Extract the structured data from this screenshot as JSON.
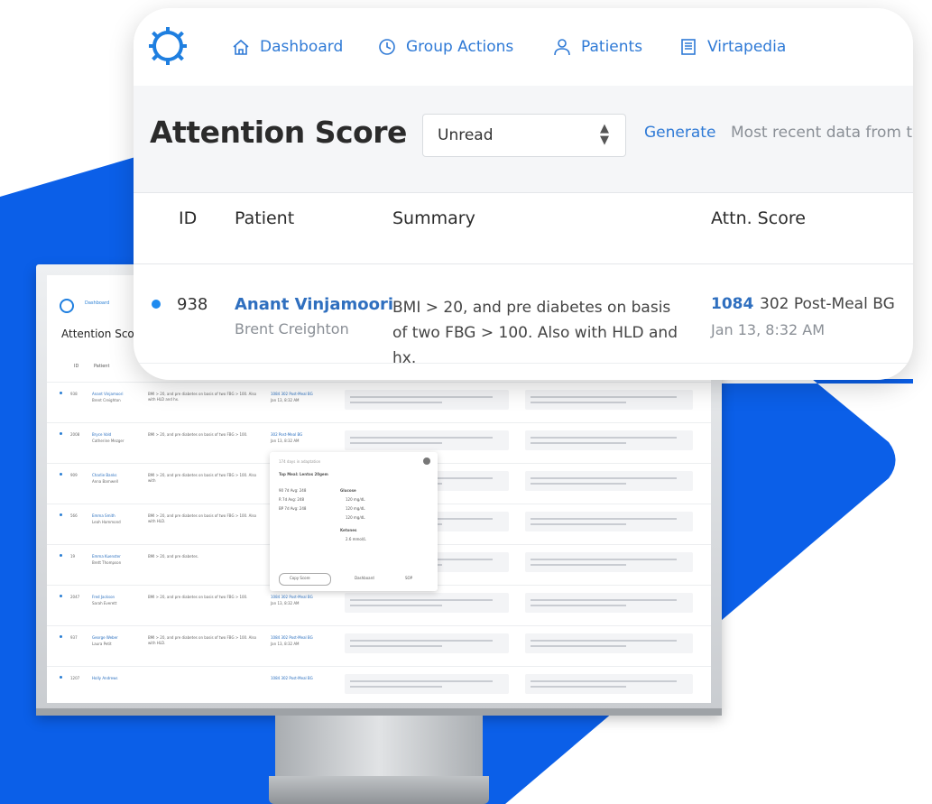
{
  "colors": {
    "brand_blue": "#0b5fe8",
    "link_blue": "#2f7ad6",
    "unread_dot": "#1f8bef"
  },
  "nav": {
    "logo_icon": "gear-icon",
    "items": [
      {
        "label": "Dashboard",
        "icon": "home-icon"
      },
      {
        "label": "Group Actions",
        "icon": "clock-icon"
      },
      {
        "label": "Patients",
        "icon": "user-icon"
      },
      {
        "label": "Virtapedia",
        "icon": "book-icon"
      }
    ]
  },
  "toolbar": {
    "title": "Attention Score",
    "filter": {
      "selected": "Unread",
      "icon": "select-arrows-icon"
    },
    "generate_label": "Generate",
    "recent_text": "Most recent data from to"
  },
  "table": {
    "columns": [
      "ID",
      "Patient",
      "Summary",
      "Attn. Score"
    ],
    "rows": [
      {
        "unread": true,
        "id": "938",
        "patient": "Anant Vinjamoori",
        "provider": "Brent Creighton",
        "summary": "BMI > 20, and pre diabetes on basis of two FBG > 100. Also with HLD and hx.",
        "score": "1084",
        "score_detail": "302 Post-Meal BG",
        "time": "Jan 13, 8:32 AM"
      }
    ]
  },
  "monitor": {
    "nav_label": "Dashboard",
    "title": "Attention Sco",
    "columns": [
      "ID",
      "Patient"
    ],
    "rows": [
      {
        "id": "938",
        "patient": "Anant Vinjamoori",
        "provider": "Brent Creighton",
        "summary": "BMI > 20, and pre diabetes on basis of two FBG > 100. Also with HLD and hx.",
        "score": "1084 302 Post-Meal BG",
        "time": "Jan 13, 8:32 AM"
      },
      {
        "id": "2008",
        "patient": "Bryce Vold",
        "provider": "Catherine Mezger",
        "summary": "BMI > 20, and pre diabetes on basis of two FBG > 100.",
        "score": "302 Post-Meal BG",
        "time": "Jan 13, 8:32 AM"
      },
      {
        "id": "909",
        "patient": "Charlie Banks",
        "provider": "Anna Barnwell",
        "summary": "BMI > 20, and pre diabetes on basis of two FBG > 100. Also with",
        "score": "",
        "time": ""
      },
      {
        "id": "566",
        "patient": "Emma Smith",
        "provider": "Leah Hammond",
        "summary": "BMI > 20, and pre diabetes on basis of two FBG > 100. Also with HLD.",
        "score": "",
        "time": ""
      },
      {
        "id": "19",
        "patient": "Emma Kuenster",
        "provider": "Brett Thompson",
        "summary": "BMI > 20, and pre diabetes.",
        "score": "",
        "time": ""
      },
      {
        "id": "2047",
        "patient": "Fred Jackson",
        "provider": "Sarah Everett",
        "summary": "BMI > 20, and pre diabetes on basis of two FBG > 100.",
        "score": "1084 302 Post-Meal BG",
        "time": "Jan 13, 8:32 AM"
      },
      {
        "id": "937",
        "patient": "George Weber",
        "provider": "Laura Petit",
        "summary": "BMI > 20, and pre diabetes on basis of two FBG > 100. Also with HLD.",
        "score": "1084 302 Post-Meal BG",
        "time": "Jan 13, 8:32 AM"
      },
      {
        "id": "1207",
        "patient": "Holly Andrews",
        "provider": "",
        "summary": "",
        "score": "1084 302 Post-Meal BG",
        "time": ""
      }
    ],
    "popup": {
      "header": "174 days in adaptation",
      "top_meal": "Top Meal: Lentos 20gem",
      "stats": [
        "90 7d Avg: 248",
        "R 7d Avg: 248",
        "BP 7d Avg: 248"
      ],
      "glucose_label": "Glucose",
      "glucose_values": [
        "120 mg/dL",
        "120 mg/dL",
        "120 mg/dL"
      ],
      "ketones_label": "Ketones",
      "ketones_value": "2.6 mmol/L",
      "buttons": [
        "Copy Score",
        "Dashboard",
        "SOP"
      ]
    }
  }
}
